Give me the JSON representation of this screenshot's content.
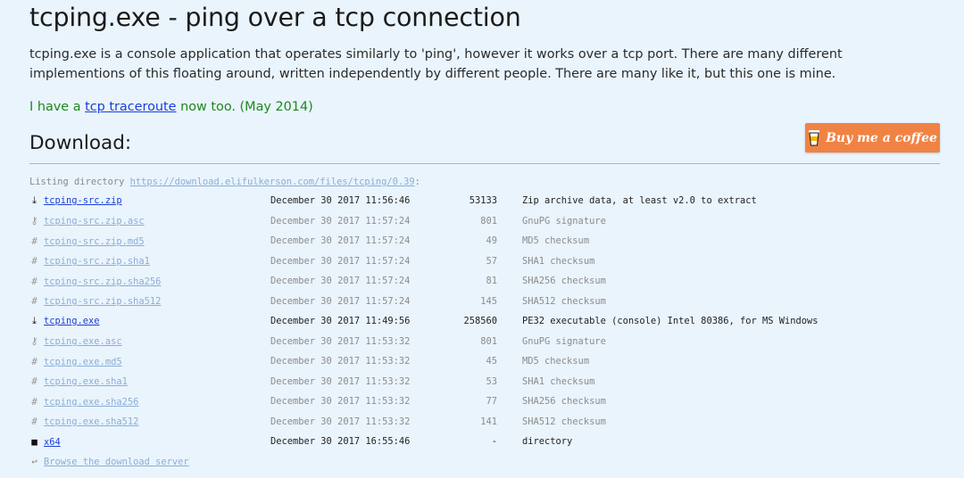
{
  "page": {
    "title": "tcping.exe - ping over a tcp connection",
    "intro": "tcping.exe is a console application that operates similarly to 'ping', however it works over a tcp port. There are many different implementions of this floating around, written independently by different people. There are many like it, but this one is mine.",
    "news_prefix": "I have a ",
    "news_link": "tcp traceroute",
    "news_suffix": " now too. (May 2014)"
  },
  "download": {
    "heading": "Download:",
    "coffee_label": "Buy me a coffee",
    "listing_prefix": "Listing directory ",
    "listing_url": "https://download.elifulkerson.com/files/tcping/0.39",
    "listing_suffix": ":",
    "files": [
      {
        "icon": "⤓",
        "name": "tcping-src.zip",
        "date": "December 30 2017 11:56:46",
        "size": "53133",
        "desc": "Zip archive data, at least v2.0 to extract",
        "main": true
      },
      {
        "icon": "⚷",
        "name": "tcping-src.zip.asc",
        "date": "December 30 2017 11:57:24",
        "size": "801",
        "desc": "GnuPG signature",
        "main": false
      },
      {
        "icon": "#",
        "name": "tcping-src.zip.md5",
        "date": "December 30 2017 11:57:24",
        "size": "49",
        "desc": "MD5 checksum",
        "main": false
      },
      {
        "icon": "#",
        "name": "tcping-src.zip.sha1",
        "date": "December 30 2017 11:57:24",
        "size": "57",
        "desc": "SHA1 checksum",
        "main": false
      },
      {
        "icon": "#",
        "name": "tcping-src.zip.sha256",
        "date": "December 30 2017 11:57:24",
        "size": "81",
        "desc": "SHA256 checksum",
        "main": false
      },
      {
        "icon": "#",
        "name": "tcping-src.zip.sha512",
        "date": "December 30 2017 11:57:24",
        "size": "145",
        "desc": "SHA512 checksum",
        "main": false
      },
      {
        "icon": "⤓",
        "name": "tcping.exe",
        "date": "December 30 2017 11:49:56",
        "size": "258560",
        "desc": "PE32 executable (console) Intel 80386, for MS Windows",
        "main": true
      },
      {
        "icon": "⚷",
        "name": "tcping.exe.asc",
        "date": "December 30 2017 11:53:32",
        "size": "801",
        "desc": "GnuPG signature",
        "main": false
      },
      {
        "icon": "#",
        "name": "tcping.exe.md5",
        "date": "December 30 2017 11:53:32",
        "size": "45",
        "desc": "MD5 checksum",
        "main": false
      },
      {
        "icon": "#",
        "name": "tcping.exe.sha1",
        "date": "December 30 2017 11:53:32",
        "size": "53",
        "desc": "SHA1 checksum",
        "main": false
      },
      {
        "icon": "#",
        "name": "tcping.exe.sha256",
        "date": "December 30 2017 11:53:32",
        "size": "77",
        "desc": "SHA256 checksum",
        "main": false
      },
      {
        "icon": "#",
        "name": "tcping.exe.sha512",
        "date": "December 30 2017 11:53:32",
        "size": "141",
        "desc": "SHA512 checksum",
        "main": false
      },
      {
        "icon": "■",
        "name": "x64",
        "date": "December 30 2017 16:55:46",
        "size": "-",
        "desc": "directory",
        "main": true
      }
    ],
    "browse_icon": "↩",
    "browse_label": "Browse the download server"
  },
  "colors": {
    "background": "#eaf4fd",
    "coffee_button": "#f08343",
    "news_text": "#1a8a1a",
    "link": "#1a3fd6"
  }
}
